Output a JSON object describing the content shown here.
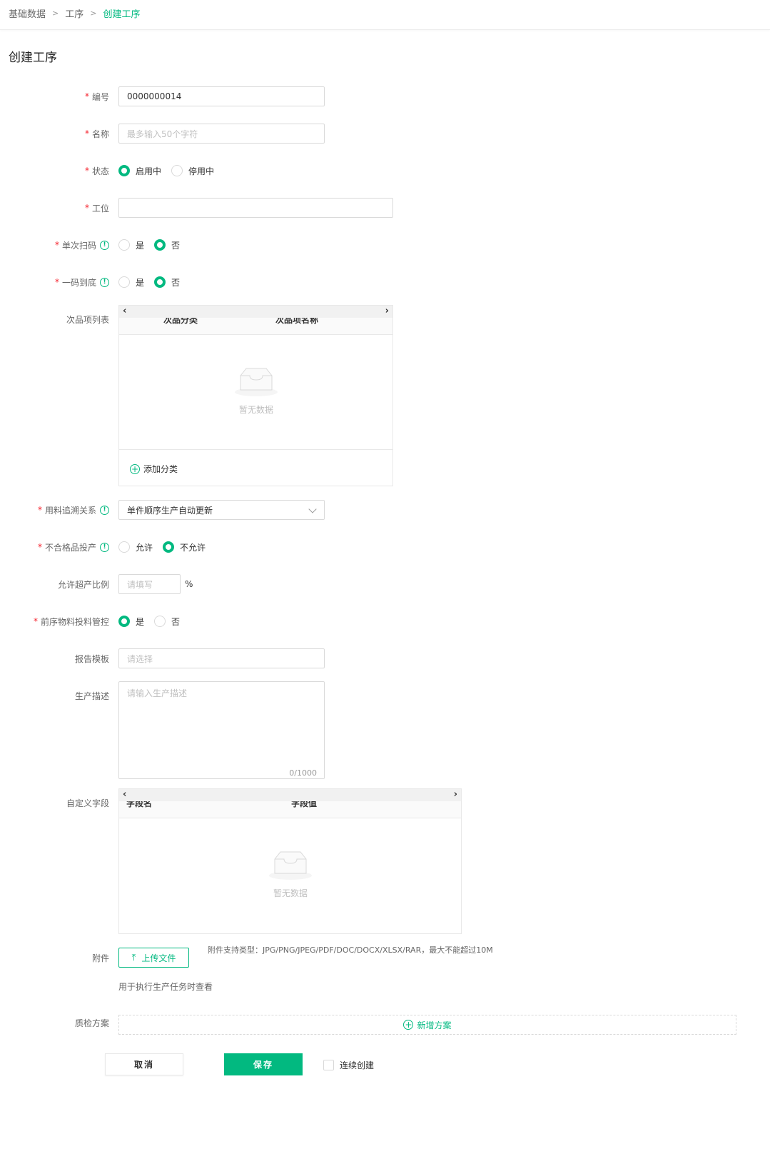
{
  "breadcrumb": {
    "items": [
      "基础数据",
      "工序"
    ],
    "current": "创建工序",
    "separator": ">"
  },
  "page_title": "创建工序",
  "form": {
    "code": {
      "label": "编号",
      "value": "0000000014"
    },
    "name": {
      "label": "名称",
      "placeholder": "最多输入50个字符"
    },
    "status": {
      "label": "状态",
      "options": [
        "启用中",
        "停用中"
      ],
      "selected": "启用中"
    },
    "workstation": {
      "label": "工位",
      "value": ""
    },
    "single_scan": {
      "label": "单次扫码",
      "options": [
        "是",
        "否"
      ],
      "selected": "否"
    },
    "one_code": {
      "label": "一码到底",
      "options": [
        "是",
        "否"
      ],
      "selected": "否"
    },
    "defect_list": {
      "label": "次品项列表",
      "columns": [
        "次品分类",
        "次品项名称"
      ],
      "empty_text": "暂无数据",
      "add_label": "添加分类"
    },
    "material_trace": {
      "label": "用料追溯关系",
      "value": "单件顺序生产自动更新"
    },
    "unqualified": {
      "label": "不合格品投产",
      "options": [
        "允许",
        "不允许"
      ],
      "selected": "不允许"
    },
    "over_ratio": {
      "label": "允许超产比例",
      "placeholder": "请填写",
      "unit": "%"
    },
    "prev_material": {
      "label": "前序物料投料管控",
      "options": [
        "是",
        "否"
      ],
      "selected": "是"
    },
    "report_template": {
      "label": "报告模板",
      "placeholder": "请选择"
    },
    "description": {
      "label": "生产描述",
      "placeholder": "请输入生产描述",
      "counter": "0/1000"
    },
    "custom_fields": {
      "label": "自定义字段",
      "columns": [
        "字段名",
        "字段值"
      ],
      "empty_text": "暂无数据"
    },
    "attachment": {
      "label": "附件",
      "button": "上传文件",
      "hint": "附件支持类型：JPG/PNG/JPEG/PDF/DOC/DOCX/XLSX/RAR，最大不能超过10M",
      "sub_hint": "用于执行生产任务时查看"
    },
    "qc_plan": {
      "label": "质检方案",
      "add_label": "新增方案"
    }
  },
  "footer": {
    "cancel": "取消",
    "save": "保存",
    "continue_create": "连续创建"
  },
  "colors": {
    "accent": "#02b980",
    "required": "#f5222d"
  }
}
